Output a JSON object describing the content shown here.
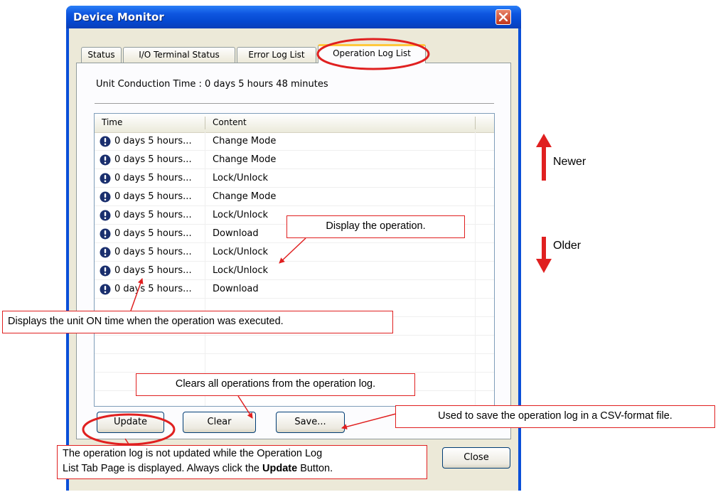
{
  "window": {
    "title": "Device Monitor"
  },
  "tabs": [
    {
      "label": "Status"
    },
    {
      "label": "I/O Terminal Status"
    },
    {
      "label": "Error Log List"
    },
    {
      "label": "Operation Log List",
      "active": true
    }
  ],
  "conduction_time": "Unit Conduction Time : 0 days 5 hours 48 minutes",
  "table": {
    "columns": [
      "Time",
      "Content"
    ],
    "rows": [
      {
        "time": "0 days 5 hours...",
        "content": "Change Mode"
      },
      {
        "time": "0 days 5 hours...",
        "content": "Change Mode"
      },
      {
        "time": "0 days 5 hours...",
        "content": "Lock/Unlock"
      },
      {
        "time": "0 days 5 hours...",
        "content": "Change Mode"
      },
      {
        "time": "0 days 5 hours...",
        "content": "Lock/Unlock"
      },
      {
        "time": "0 days 5 hours...",
        "content": "Download"
      },
      {
        "time": "0 days 5 hours...",
        "content": "Lock/Unlock"
      },
      {
        "time": "0 days 5 hours...",
        "content": "Lock/Unlock"
      },
      {
        "time": "0 days 5 hours...",
        "content": "Download"
      }
    ],
    "row_icon": "info-icon"
  },
  "buttons": {
    "update": "Update",
    "clear": "Clear",
    "save": "Save...",
    "close": "Close"
  },
  "annotations": {
    "display_operation": "Display the operation.",
    "unit_on_time": "Displays the unit ON time when the operation was executed.",
    "clears_all": "Clears all operations from the operation log.",
    "csv_save": "Used to save the operation log in a CSV-format file.",
    "update_note_line1": "The operation log is not updated while the Operation Log",
    "update_note_line2_prefix": "List Tab Page is displayed. Always click the ",
    "update_note_bold": "Update",
    "update_note_suffix": " Button.",
    "newer": "Newer",
    "older": "Older"
  },
  "colors": {
    "annotation_red": "#e02020",
    "titlebar_blue": "#0a4fd8",
    "dialog_face": "#ece9d8",
    "active_tab_accent": "#ffc83c"
  }
}
